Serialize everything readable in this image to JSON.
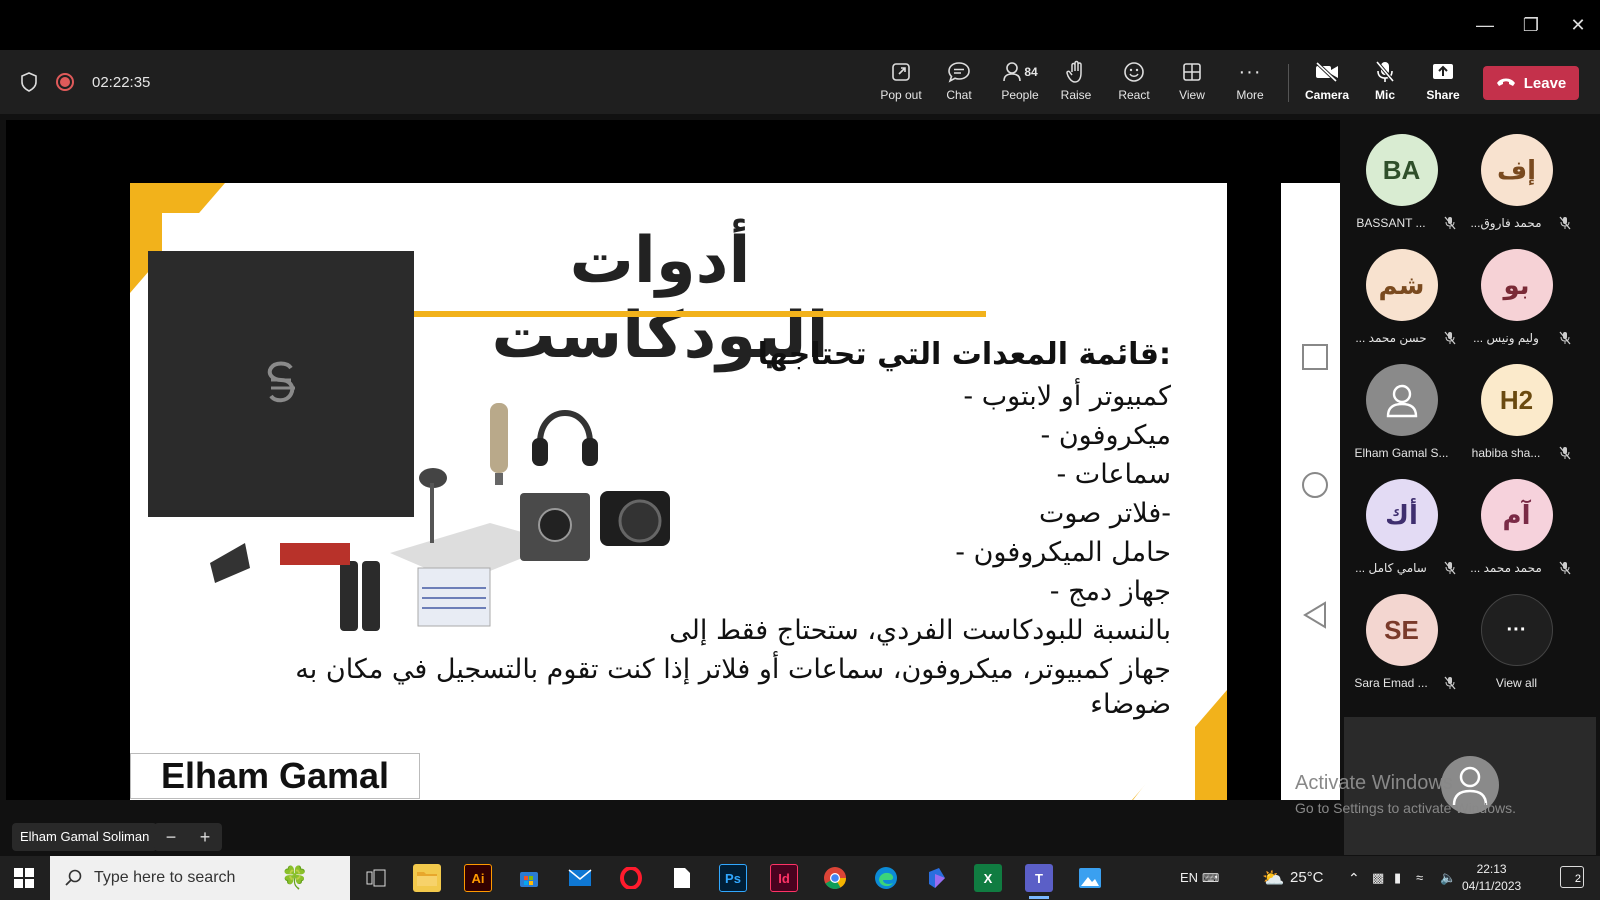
{
  "window": {
    "minimize_icon": "minimize-icon",
    "restore_icon": "restore-icon",
    "close_icon": "close-icon"
  },
  "meeting": {
    "timer": "02:22:35",
    "people_count": "84",
    "toolbar": {
      "pop_out": "Pop out",
      "chat": "Chat",
      "people": "People",
      "raise": "Raise",
      "react": "React",
      "view": "View",
      "more": "More",
      "camera": "Camera",
      "mic": "Mic",
      "share": "Share",
      "leave": "Leave"
    }
  },
  "slide": {
    "title": "أدوات البودكاست",
    "heading": ":قائمة المعدات التي تحتاجها",
    "lines": [
      "كمبيوتر أو لابتوب -",
      "ميكروفون -",
      "سماعات -",
      "-فلاتر صوت",
      "حامل الميكروفون -",
      "جهاز دمج -",
      "بالنسبة للبودكاست الفردي، ستحتاج فقط إلى",
      "جهاز كمبيوتر، ميكروفون، سماعات أو فلاتر إذا كنت تقوم بالتسجيل في مكان به",
      "ضوضاء"
    ],
    "presenter_name": "Elham Gamal"
  },
  "stage": {
    "presenter_pill": "Elham Gamal Soliman",
    "zoom_out": "−",
    "zoom_in": "+"
  },
  "participants": [
    {
      "initials": "BA",
      "name": "BASSANT ...",
      "bg": "#d9ecd2",
      "fg": "#2f4f2a",
      "muted": true
    },
    {
      "initials": "إف",
      "name": "...محمد فاروق",
      "bg": "#f8e2cf",
      "fg": "#7a4a1f",
      "muted": true
    },
    {
      "initials": "شم",
      "name": "... حسن محمد",
      "bg": "#f8e2cf",
      "fg": "#7a4a1f",
      "muted": true
    },
    {
      "initials": "بو",
      "name": "... وليم ونيس",
      "bg": "#f6d2d6",
      "fg": "#7a2a36",
      "muted": true
    },
    {
      "initials": "",
      "name": "Elham Gamal S...",
      "bg": "#8a8a8a",
      "fg": "#ffffff",
      "muted": false,
      "generic": true
    },
    {
      "initials": "H2",
      "name": "habiba sha...",
      "bg": "#fbeacb",
      "fg": "#6a4a10",
      "muted": true
    },
    {
      "initials": "أك",
      "name": "... سامي كامل",
      "bg": "#e3dbf4",
      "fg": "#3f2f6f",
      "muted": true
    },
    {
      "initials": "آم",
      "name": "... محمد محمد",
      "bg": "#f6d2dc",
      "fg": "#7a2a46",
      "muted": true
    },
    {
      "initials": "SE",
      "name": "Sara Emad ...",
      "bg": "#f3d6d0",
      "fg": "#7a3a2a",
      "muted": true
    }
  ],
  "view_all": "View all",
  "watermark": {
    "title": "Activate Windows",
    "subtitle": "Go to Settings to activate Windows."
  },
  "taskbar": {
    "search_placeholder": "Type here to search",
    "apps": [
      "task-view",
      "file-explorer",
      "illustrator",
      "microsoft-store",
      "mail",
      "opera",
      "notepad",
      "photoshop",
      "indesign",
      "chrome",
      "edge",
      "copilot",
      "excel",
      "teams",
      "photos"
    ],
    "ai_label": "Ai",
    "ps_label": "Ps",
    "id_label": "Id",
    "language": "EN",
    "temperature": "25°C",
    "time": "22:13",
    "date": "04/11/2023",
    "notifications": "2"
  },
  "colors": {
    "accent_yellow": "#f2b21b",
    "leave_red": "#c4314b",
    "toolbar_bg": "#1f1f1f"
  }
}
